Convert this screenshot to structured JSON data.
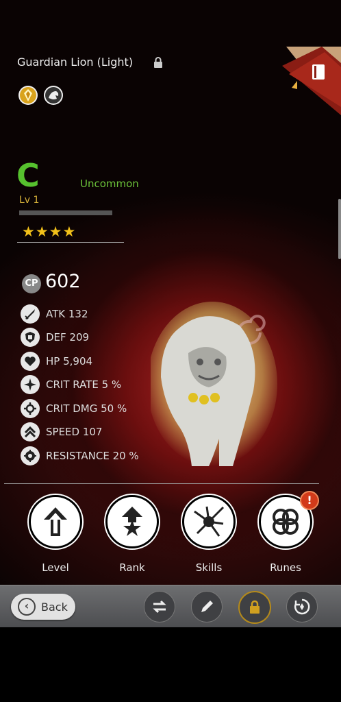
{
  "monster": {
    "name": "Guardian Lion (Light)",
    "grade": "C",
    "rarity": "Uncommon",
    "level": "Lv 1",
    "stars": "★★★★",
    "star_count": 4,
    "cp_label": "CP",
    "cp_value": "602",
    "xp_progress": 0
  },
  "stats": [
    {
      "label": "ATK 132",
      "icon": "sword-icon"
    },
    {
      "label": "DEF 209",
      "icon": "shield-icon"
    },
    {
      "label": "HP 5,904",
      "icon": "heart-icon"
    },
    {
      "label": "CRIT RATE 5 %",
      "icon": "crit-rate-icon"
    },
    {
      "label": "CRIT DMG 50 %",
      "icon": "crit-dmg-icon"
    },
    {
      "label": "SPEED 107",
      "icon": "speed-icon"
    },
    {
      "label": "RESISTANCE 20 %",
      "icon": "resistance-icon"
    }
  ],
  "actions": [
    {
      "label": "Level",
      "icon": "level-up-icon"
    },
    {
      "label": "Rank",
      "icon": "rank-up-icon"
    },
    {
      "label": "Skills",
      "icon": "skills-icon"
    },
    {
      "label": "Runes",
      "icon": "runes-icon"
    }
  ],
  "runes_alert": "!",
  "bottom": {
    "back_label": "Back",
    "tools": [
      "swap-icon",
      "edit-icon",
      "lock-icon",
      "evolve-icon"
    ]
  },
  "colors": {
    "grade": "#56c12e",
    "rarity": "#6cc43a",
    "level": "#d8b23a",
    "star": "#f2c11a",
    "alert": "#d23a1a"
  }
}
